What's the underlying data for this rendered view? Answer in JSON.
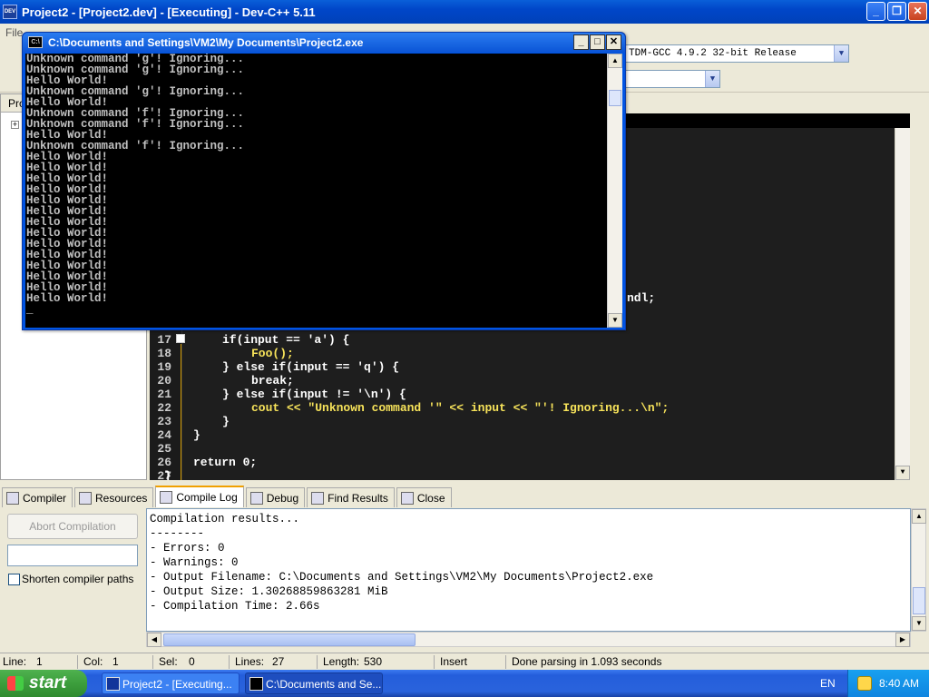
{
  "window": {
    "title": "Project2 - [Project2.dev] - [Executing] - Dev-C++ 5.11",
    "app_icon_text": "DEV"
  },
  "menubar": {
    "first_item": "File"
  },
  "toolbar": {
    "compiler_select": "TDM-GCC 4.9.2 32-bit Release"
  },
  "left_panel": {
    "tab_label": "Pro"
  },
  "editor": {
    "partial_text": "ndl;",
    "lines": [
      {
        "n": "17",
        "code": "if(input == 'a') {"
      },
      {
        "n": "18",
        "code": "Foo();"
      },
      {
        "n": "19",
        "code": "} else if(input == 'q') {"
      },
      {
        "n": "20",
        "code": "break;"
      },
      {
        "n": "21",
        "code": "} else if(input != '\\n') {"
      },
      {
        "n": "22",
        "code": "cout << \"Unknown command '\" << input << \"'! Ignoring...\\n\";"
      },
      {
        "n": "23",
        "code": "}"
      },
      {
        "n": "24",
        "code": "}"
      },
      {
        "n": "25",
        "code": ""
      },
      {
        "n": "26",
        "code": "return 0;"
      },
      {
        "n": "27",
        "code": "}"
      }
    ]
  },
  "console": {
    "title": "C:\\Documents and Settings\\VM2\\My Documents\\Project2.exe",
    "icon_text": "C:\\",
    "output": "Unknown command 'g'! Ignoring...\nUnknown command 'g'! Ignoring...\nHello World!\nUnknown command 'g'! Ignoring...\nHello World!\nUnknown command 'f'! Ignoring...\nUnknown command 'f'! Ignoring...\nHello World!\nUnknown command 'f'! Ignoring...\nHello World!\nHello World!\nHello World!\nHello World!\nHello World!\nHello World!\nHello World!\nHello World!\nHello World!\nHello World!\nHello World!\nHello World!\nHello World!\nHello World!\n_"
  },
  "bottom_tabs": [
    {
      "label": "Compiler",
      "icon": "compiler-icon"
    },
    {
      "label": "Resources",
      "icon": "resources-icon"
    },
    {
      "label": "Compile Log",
      "icon": "compile-log-icon",
      "active": true
    },
    {
      "label": "Debug",
      "icon": "debug-icon"
    },
    {
      "label": "Find Results",
      "icon": "find-results-icon"
    },
    {
      "label": "Close",
      "icon": "close-tab-icon"
    }
  ],
  "compile_panel": {
    "abort_label": "Abort Compilation",
    "shorten_label": "Shorten compiler paths",
    "log": "Compilation results...\n--------\n- Errors: 0\n- Warnings: 0\n- Output Filename: C:\\Documents and Settings\\VM2\\My Documents\\Project2.exe\n- Output Size: 1.30268859863281 MiB\n- Compilation Time: 2.66s"
  },
  "statusbar": {
    "line_label": "Line:",
    "line_value": "1",
    "col_label": "Col:",
    "col_value": "1",
    "sel_label": "Sel:",
    "sel_value": "0",
    "lines_label": "Lines:",
    "lines_value": "27",
    "length_label": "Length:",
    "length_value": "530",
    "mode": "Insert",
    "message": "Done parsing in 1.093 seconds"
  },
  "taskbar": {
    "start_label": "start",
    "items": [
      {
        "label": "Project2 - [Executing..."
      },
      {
        "label": "C:\\Documents and Se..."
      }
    ],
    "language": "EN",
    "clock": "8:40 AM"
  }
}
